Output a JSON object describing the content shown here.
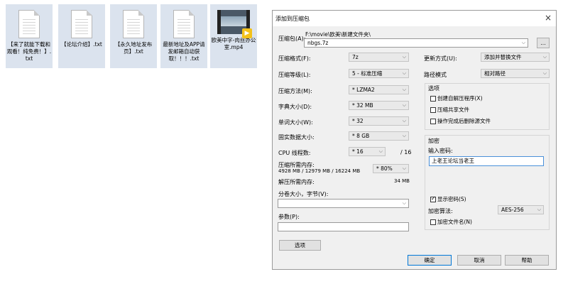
{
  "desktop": {
    "files": [
      {
        "name": "【来了就能下载和观看！纯免费！】.txt",
        "type": "txt"
      },
      {
        "name": "【论坛介绍】.txt",
        "type": "txt"
      },
      {
        "name": "【永久地址发布页】.txt",
        "type": "txt"
      },
      {
        "name": "最新地址及APP请发邮箱自动获取！！！.txt",
        "type": "txt"
      },
      {
        "name": "欧美中字-肉丝办公室.mp4",
        "type": "video"
      }
    ]
  },
  "dialog": {
    "title": "添加到压缩包",
    "close_icon": "×",
    "archive_label": "压缩包(A):",
    "archive_path": "F:\\movie\\欧美\\新建文件夹\\",
    "archive_name": "nbgs.7z",
    "browse_label": "...",
    "format_label": "压缩格式(F):",
    "format_value": "7z",
    "level_label": "压缩等级(L):",
    "level_value": "5 - 标准压缩",
    "method_label": "压缩方法(M):",
    "method_value": "* LZMA2",
    "dict_label": "字典大小(D):",
    "dict_value": "* 32 MB",
    "word_label": "单词大小(W):",
    "word_value": "* 32",
    "solid_label": "固实数据大小:",
    "solid_value": "* 8 GB",
    "cpu_label": "CPU 线程数:",
    "cpu_value": "* 16",
    "cpu_total": "/ 16",
    "mem_comp_label": "压缩所需内存:",
    "mem_comp_value": "4928 MB / 12979 MB / 16224 MB",
    "mem_percent": "* 80%",
    "mem_decomp_label": "解压所需内存:",
    "mem_decomp_value": "34 MB",
    "split_label": "分卷大小，字节(V):",
    "split_value": "",
    "params_label": "参数(P):",
    "params_value": "",
    "options_button": "选项",
    "update_label": "更新方式(U):",
    "update_value": "添加并替换文件",
    "pathmode_label": "路径模式",
    "pathmode_value": "相对路径",
    "options_group": "选项",
    "opt_sfx": "创建自解压程序(X)",
    "opt_shared": "压缩共享文件",
    "opt_delete": "操作完成后删除源文件",
    "encrypt_group": "加密",
    "password_label": "输入密码:",
    "password_value": "上老王论坛当老王",
    "show_password": "显示密码(S)",
    "encrypt_method_label": "加密算法:",
    "encrypt_method_value": "AES-256",
    "encrypt_names": "加密文件名(N)",
    "ok_button": "确定",
    "cancel_button": "取消",
    "help_button": "帮助"
  }
}
